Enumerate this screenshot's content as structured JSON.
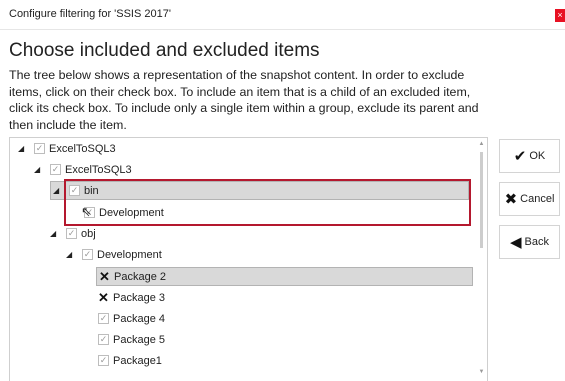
{
  "window": {
    "title": "Configure filtering for 'SSIS 2017'",
    "close_glyph": "×"
  },
  "header": {
    "heading": "Choose included and excluded items",
    "description": "The tree below shows a representation of the snapshot content. In order to exclude items, click on their check box. To include an item that is a child of an excluded item, click its check box. To include only a single item within a group, exclude its parent and then include the item."
  },
  "tree": {
    "items": [
      {
        "label": "ExcelToSQL3",
        "check": "checked",
        "expander": "expanded"
      },
      {
        "label": "ExcelToSQL3",
        "check": "checked",
        "expander": "expanded"
      },
      {
        "label": "bin",
        "check": "checked",
        "expander": "expanded"
      },
      {
        "label": "Development",
        "check": "checked",
        "expander": "none"
      },
      {
        "label": "obj",
        "check": "checked",
        "expander": "expanded"
      },
      {
        "label": "Development",
        "check": "checked",
        "expander": "expanded"
      },
      {
        "label": "Package 2",
        "check": "excluded",
        "expander": "none",
        "selected": true
      },
      {
        "label": "Package 3",
        "check": "excluded",
        "expander": "none"
      },
      {
        "label": "Package 4",
        "check": "checked",
        "expander": "none"
      },
      {
        "label": "Package 5",
        "check": "checked",
        "expander": "none"
      },
      {
        "label": "Package1",
        "check": "checked",
        "expander": "none"
      }
    ],
    "glyphs": {
      "expanded": "◢",
      "checked": "✓",
      "excluded": "✕"
    }
  },
  "buttons": {
    "ok": {
      "label": "OK",
      "icon": "checkmark-icon",
      "glyph": "✔"
    },
    "cancel": {
      "label": "Cancel",
      "icon": "x-icon",
      "glyph": "✖"
    },
    "back": {
      "label": "Back",
      "icon": "back-arrow-icon",
      "glyph": "◀"
    }
  },
  "colors": {
    "highlight_border": "#b4182e",
    "selected_row": "#d9d9d9",
    "close_button": "#e81123"
  }
}
